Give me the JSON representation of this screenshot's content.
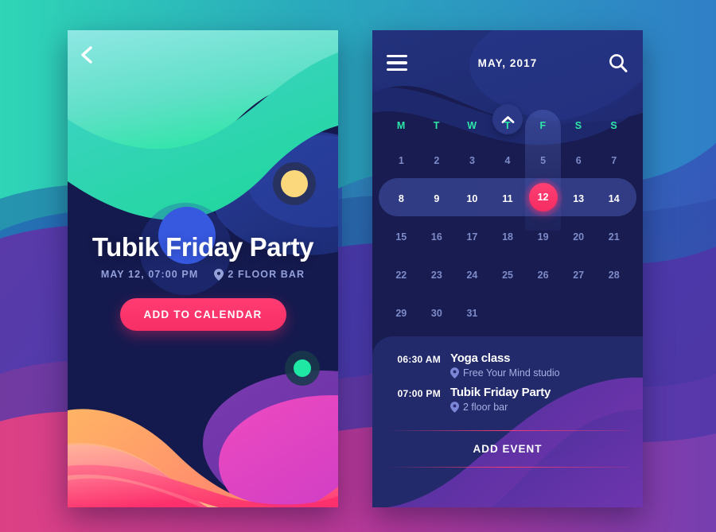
{
  "theme": {
    "accent_pink": "#FA3C68",
    "accent_mint": "#2EE6A8",
    "card_navy": "#181C50",
    "text_muted": "#7D8BC9"
  },
  "left_screen": {
    "back_icon": "chevron-left-icon",
    "event": {
      "title": "Tubik Friday Party",
      "date_time": "MAY 12, 07:00 PM",
      "location_icon": "location-pin-icon",
      "location": "2 FLOOR BAR"
    },
    "cta_label": "ADD TO CALENDAR"
  },
  "right_screen": {
    "header": {
      "menu_icon": "hamburger-menu-icon",
      "title": "MAY, 2017",
      "search_icon": "search-icon"
    },
    "collapse_icon": "chevron-up-icon",
    "expand_icon": "chevron-down-icon",
    "calendar": {
      "day_initials": [
        "M",
        "T",
        "W",
        "T",
        "F",
        "S",
        "S"
      ],
      "highlighted_weekday_index": 4,
      "selected_day": "12",
      "selected_week_index": 1,
      "weeks": [
        [
          "1",
          "2",
          "3",
          "4",
          "5",
          "6",
          "7"
        ],
        [
          "8",
          "9",
          "10",
          "11",
          "12",
          "13",
          "14"
        ],
        [
          "15",
          "16",
          "17",
          "18",
          "19",
          "20",
          "21"
        ],
        [
          "22",
          "23",
          "24",
          "25",
          "26",
          "27",
          "28"
        ],
        [
          "29",
          "30",
          "31",
          "",
          "",
          "",
          ""
        ]
      ]
    },
    "events": [
      {
        "time": "06:30 AM",
        "title": "Yoga class",
        "location_icon": "location-pin-icon",
        "location": "Free Your Mind studio"
      },
      {
        "time": "07:00 PM",
        "title": "Tubik Friday Party",
        "location_icon": "location-pin-icon",
        "location": "2 floor bar"
      }
    ],
    "add_event_label": "ADD EVENT"
  }
}
